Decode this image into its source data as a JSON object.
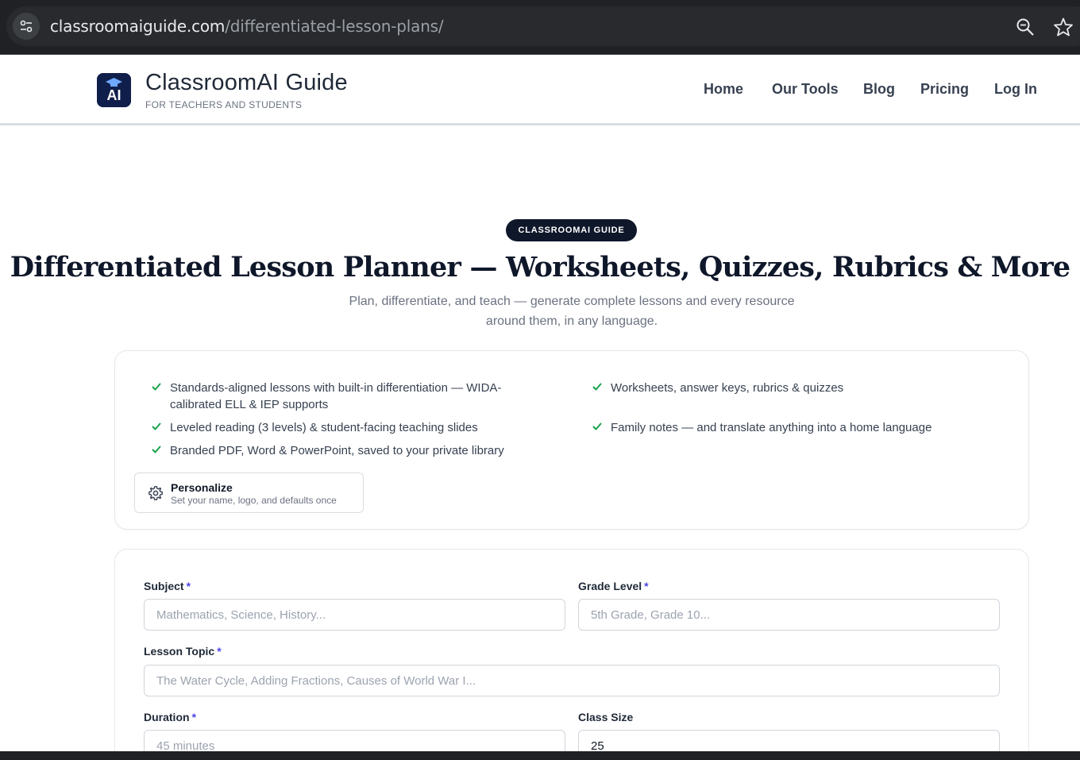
{
  "browser": {
    "url_host": "classroomaiguide.com",
    "url_path": "/differentiated-lesson-plans/",
    "site_info_icon": "tune-icon",
    "zoom_icon": "zoom-icon",
    "bookmark_icon": "star-icon"
  },
  "header": {
    "logo_text": "AI",
    "brand_name": "ClassroomAI Guide",
    "tagline": "FOR TEACHERS AND STUDENTS",
    "nav": {
      "home": "Home",
      "tools": "Our Tools",
      "blog": "Blog",
      "pricing": "Pricing",
      "login": "Log In"
    }
  },
  "hero": {
    "badge": "CLASSROOMAI GUIDE",
    "title": "Differentiated Lesson Planner — Worksheets, Quizzes, Rubrics & More",
    "subtitle_line1": "Plan, differentiate, and teach — generate complete lessons and every resource",
    "subtitle_line2": "around them, in any language."
  },
  "features": {
    "items": [
      {
        "line1": "Standards-aligned lessons with built-in differentiation — WIDA-",
        "line2": "calibrated ELL & IEP supports"
      },
      {
        "line1": "Leveled reading (3 levels) & student-facing teaching slides"
      },
      {
        "line1": "Branded PDF, Word & PowerPoint, saved to your private library"
      },
      {
        "line1": "Worksheets, answer keys, rubrics & quizzes"
      },
      {
        "line1": "Family notes — and translate anything into a home language"
      }
    ],
    "accent_color": "#16a34a",
    "personalize": {
      "title": "Personalize",
      "subtitle": "Set your name, logo, and defaults once"
    }
  },
  "form": {
    "required_mark": "*",
    "subject": {
      "label": "Subject",
      "placeholder": "Mathematics, Science, History..."
    },
    "grade": {
      "label": "Grade Level",
      "placeholder": "5th Grade, Grade 10..."
    },
    "topic": {
      "label": "Lesson Topic",
      "placeholder": "The Water Cycle, Adding Fractions, Causes of World War I..."
    },
    "duration": {
      "label": "Duration",
      "placeholder": "45 minutes"
    },
    "class_size": {
      "label": "Class Size",
      "value": "25"
    }
  }
}
